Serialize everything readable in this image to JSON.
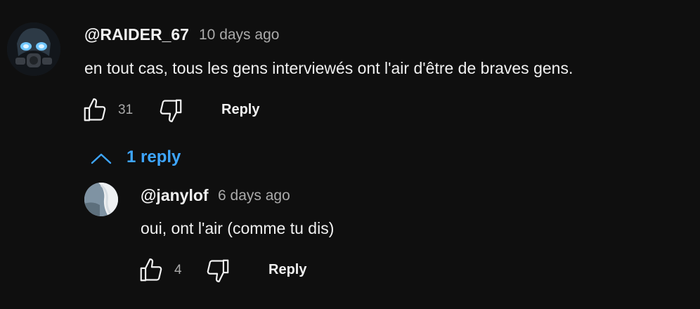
{
  "thread": {
    "comment": {
      "author": "@RAIDER_67",
      "time": "10 days ago",
      "text": "en tout cas, tous les gens interviewés ont l'air d'être de braves gens.",
      "likes": "31",
      "reply_label": "Reply"
    },
    "replies_toggle": {
      "label": "1 reply",
      "icon": "chevron-up-icon",
      "color": "#3ea6ff"
    },
    "reply": {
      "author": "@janylof",
      "time": "6 days ago",
      "text": "oui, ont l'air (comme tu dis)",
      "likes": "4",
      "reply_label": "Reply"
    }
  },
  "colors": {
    "background": "#0f0f0f",
    "text": "#f1f1f1",
    "muted": "#aaaaaa",
    "link": "#3ea6ff"
  }
}
